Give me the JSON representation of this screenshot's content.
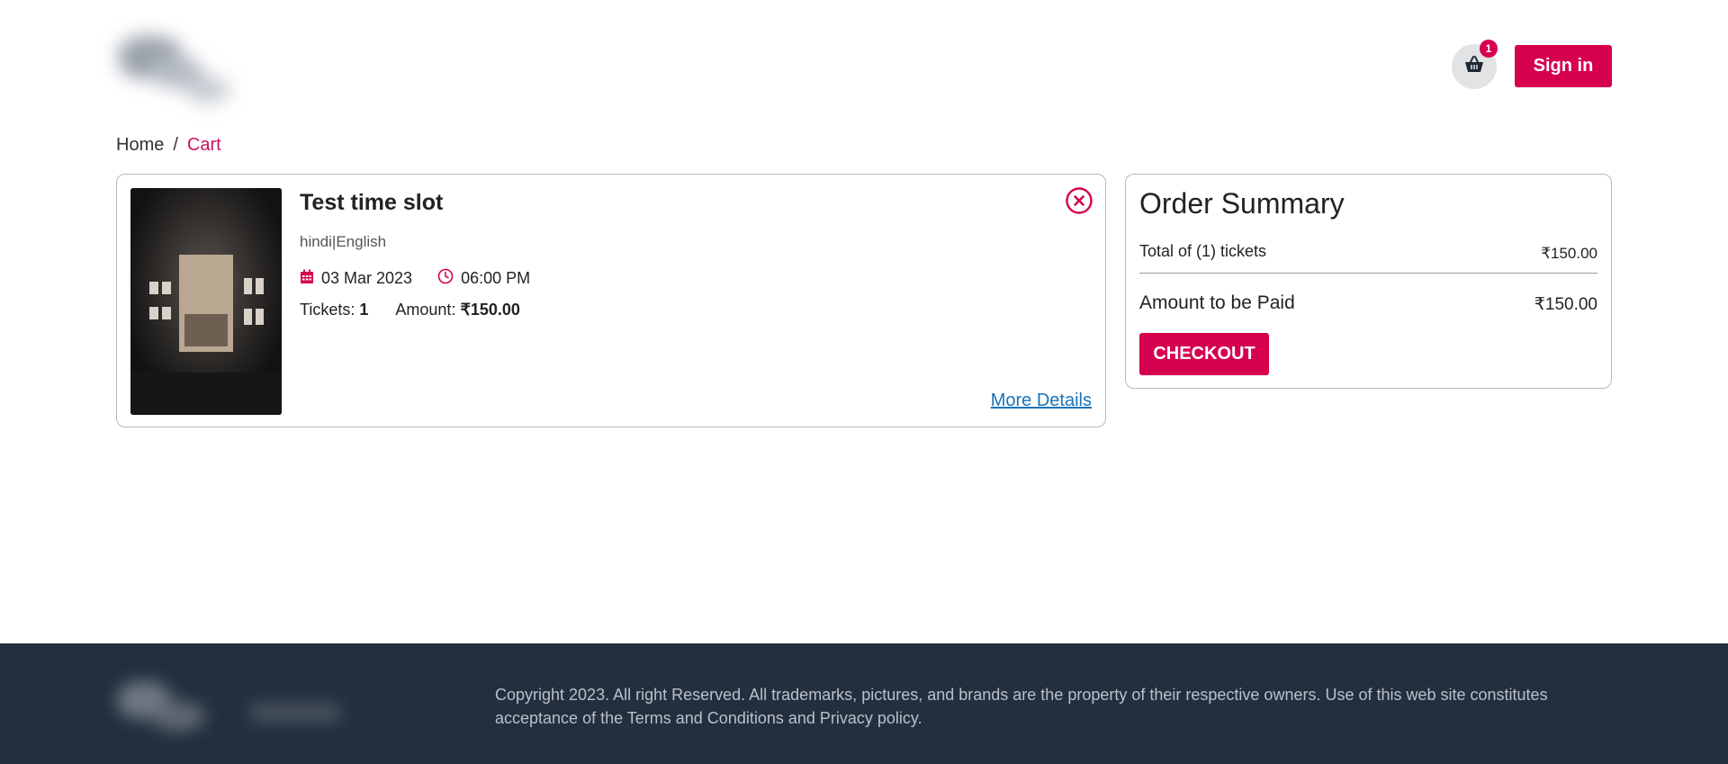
{
  "header": {
    "logo_alt": "logo",
    "cart_count": "1",
    "signin_label": "Sign in"
  },
  "breadcrumb": {
    "home": "Home",
    "separator": "/",
    "current": "Cart"
  },
  "cart_item": {
    "title": "Test time slot",
    "languages": "hindi|English",
    "date": "03 Mar 2023",
    "time": "06:00 PM",
    "tickets_label": "Tickets:",
    "tickets_value": "1",
    "amount_label": "Amount:",
    "amount_value": "₹150.00",
    "more_details": "More Details"
  },
  "summary": {
    "title": "Order Summary",
    "total_label": "Total of (1) tickets",
    "total_value": "₹150.00",
    "paid_label": "Amount to be Paid",
    "paid_value": "₹150.00",
    "checkout_label": "CHECKOUT"
  },
  "footer": {
    "copyright": "Copyright 2023. All right Reserved. All trademarks, pictures, and brands are the property of their respective owners. Use of this web site constitutes acceptance of the Terms and Conditions and Privacy policy."
  },
  "colors": {
    "accent": "#d6004f",
    "link": "#1a73b8",
    "footer_bg": "#232f3e"
  }
}
